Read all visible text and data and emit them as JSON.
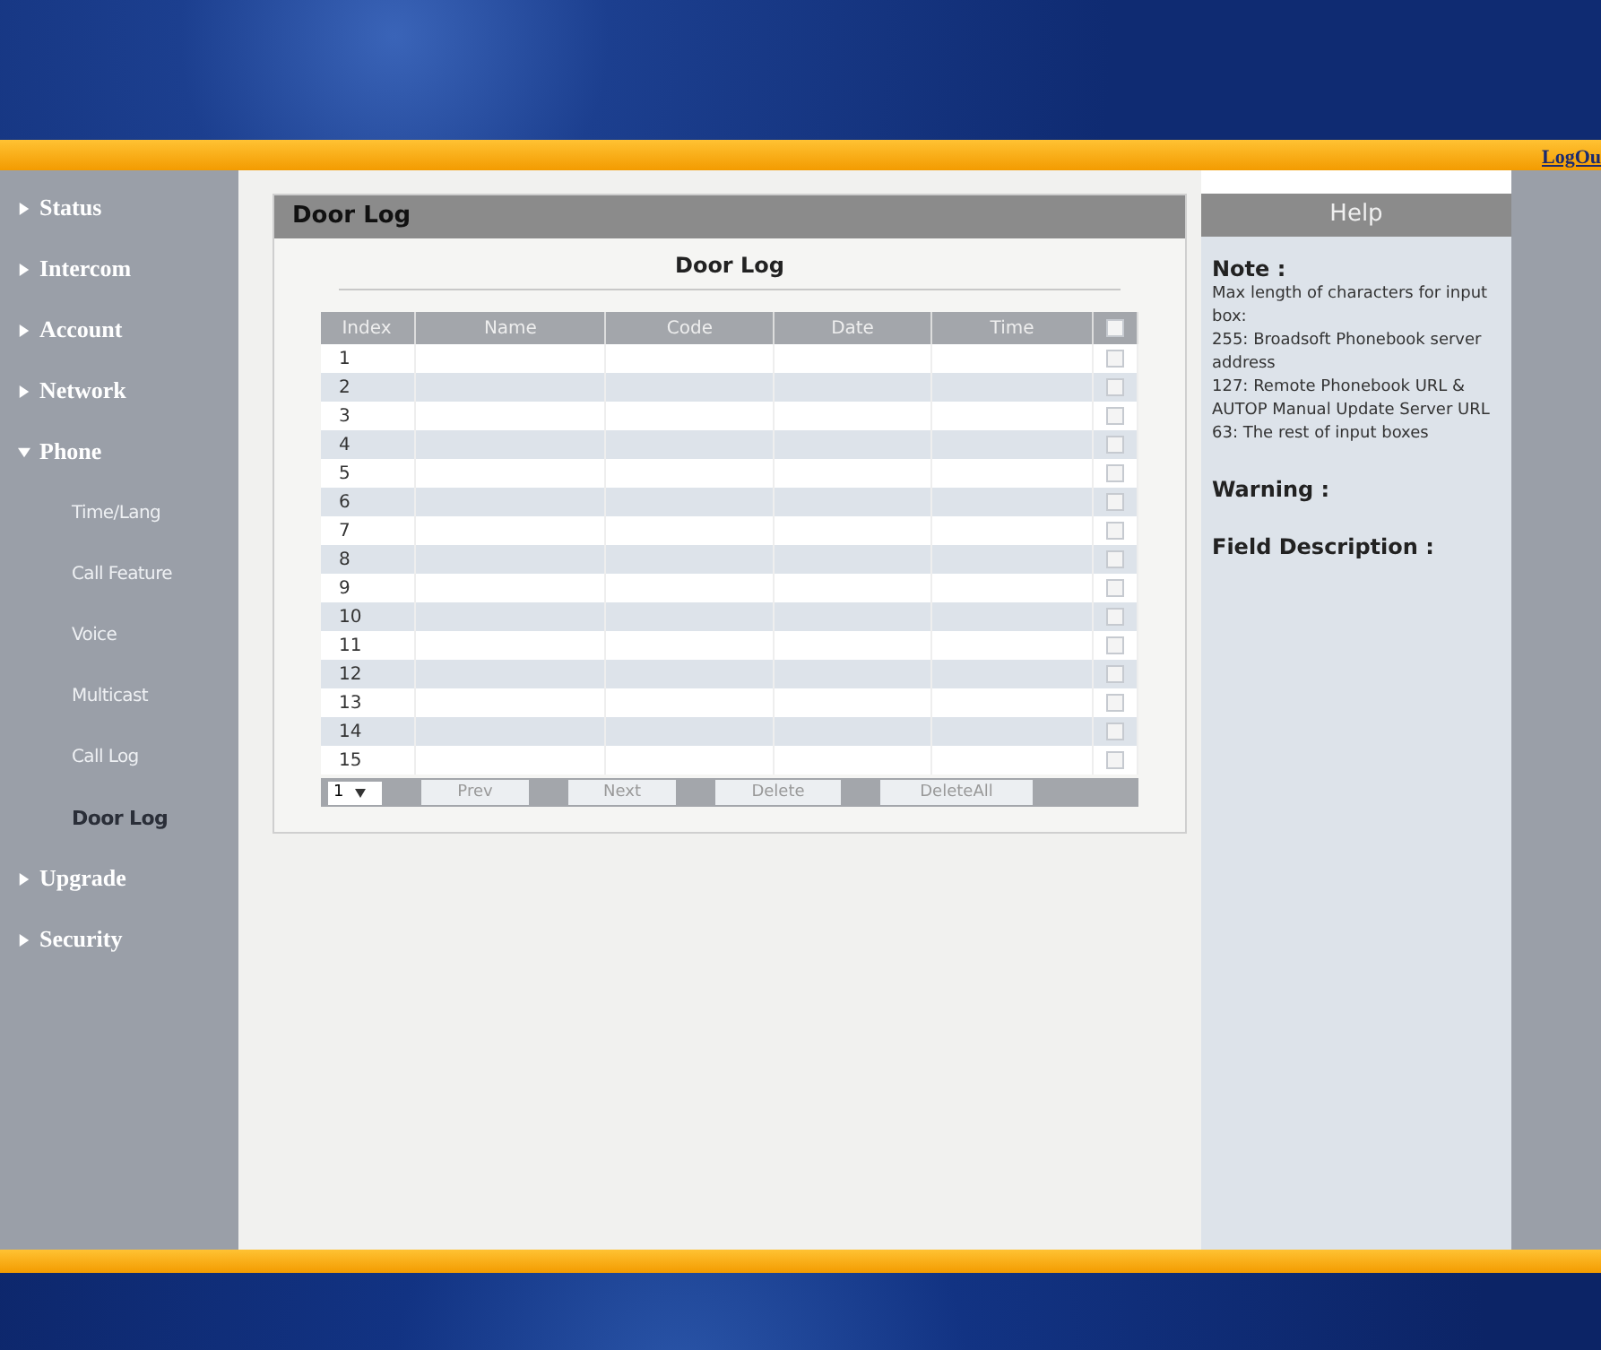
{
  "header": {
    "logout": "LogOu"
  },
  "sidebar": {
    "items": [
      {
        "kind": "section",
        "label": "Status",
        "expanded": false
      },
      {
        "kind": "section",
        "label": "Intercom",
        "expanded": false
      },
      {
        "kind": "section",
        "label": "Account",
        "expanded": false
      },
      {
        "kind": "section",
        "label": "Network",
        "expanded": false
      },
      {
        "kind": "section",
        "label": "Phone",
        "expanded": true
      },
      {
        "kind": "sub",
        "label": "Time/Lang",
        "selected": false
      },
      {
        "kind": "sub",
        "label": "Call Feature",
        "selected": false
      },
      {
        "kind": "sub",
        "label": "Voice",
        "selected": false
      },
      {
        "kind": "sub",
        "label": "Multicast",
        "selected": false
      },
      {
        "kind": "sub",
        "label": "Call Log",
        "selected": false
      },
      {
        "kind": "sub",
        "label": "Door Log",
        "selected": true
      },
      {
        "kind": "section",
        "label": "Upgrade",
        "expanded": false
      },
      {
        "kind": "section",
        "label": "Security",
        "expanded": false
      }
    ]
  },
  "panel": {
    "title": "Door Log",
    "heading": "Door Log",
    "table": {
      "columns": [
        "Index",
        "Name",
        "Code",
        "Date",
        "Time"
      ],
      "header_checked": false,
      "rows": [
        {
          "index": "1",
          "checked": false
        },
        {
          "index": "2",
          "checked": false
        },
        {
          "index": "3",
          "checked": false
        },
        {
          "index": "4",
          "checked": false
        },
        {
          "index": "5",
          "checked": false
        },
        {
          "index": "6",
          "checked": false
        },
        {
          "index": "7",
          "checked": false
        },
        {
          "index": "8",
          "checked": false
        },
        {
          "index": "9",
          "checked": false
        },
        {
          "index": "10",
          "checked": false
        },
        {
          "index": "11",
          "checked": false
        },
        {
          "index": "12",
          "checked": false
        },
        {
          "index": "13",
          "checked": false
        },
        {
          "index": "14",
          "checked": false
        },
        {
          "index": "15",
          "checked": false
        }
      ]
    },
    "footer": {
      "page": "1",
      "buttons": [
        "Prev",
        "Next",
        "Delete",
        "DeleteAll"
      ]
    }
  },
  "help": {
    "title": "Help",
    "note_label": "Note :",
    "note_lines": [
      "Max length of characters for input box:",
      "255: Broadsoft Phonebook server address",
      "127: Remote Phonebook URL & AUTOP Manual Update Server URL",
      "63: The rest of input boxes"
    ],
    "warning_label": "Warning :",
    "field_label": "Field Description :"
  }
}
